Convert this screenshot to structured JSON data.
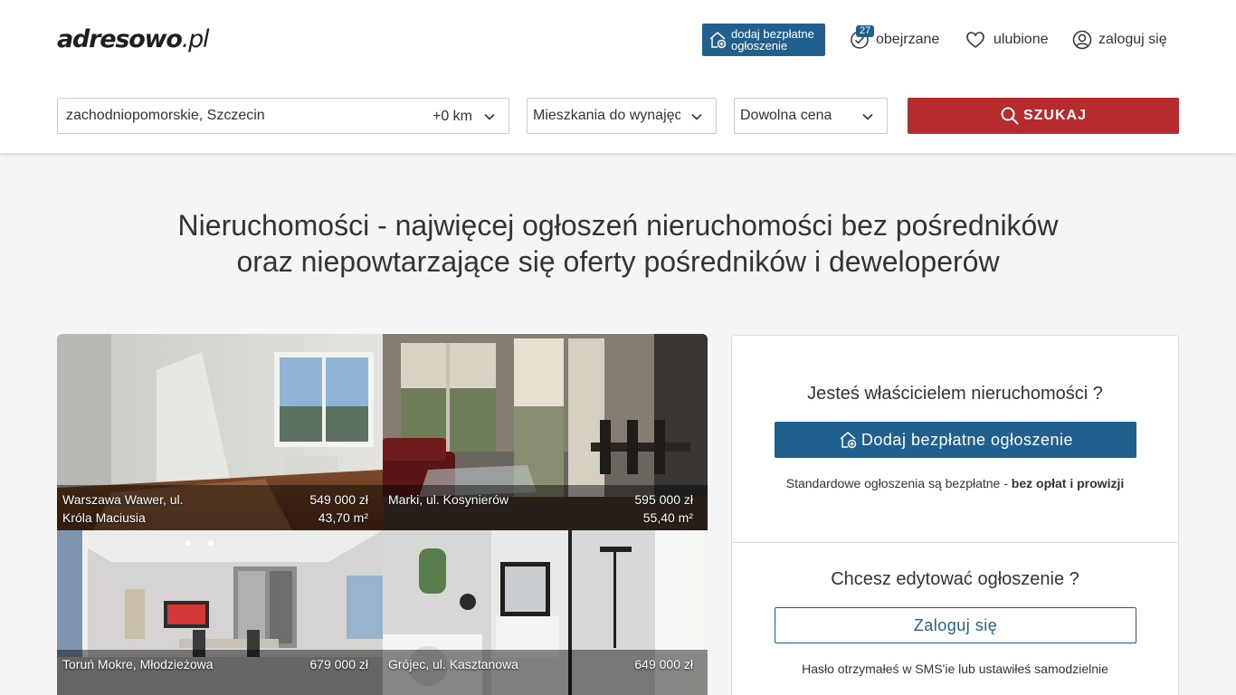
{
  "logo": {
    "main": "adresowo",
    "tld": ".pl"
  },
  "nav": {
    "add_listing": "dodaj bezpłatne ogłoszenie",
    "viewed": "obejrzane",
    "viewed_count": "27",
    "favorites": "ulubione",
    "login": "zaloguj się"
  },
  "search": {
    "location": "zachodniopomorskie,  Szczecin",
    "radius": "+0 km",
    "category": "Mieszkania do wynajęcia",
    "price": "Dowolna cena",
    "button": "SZUKAJ"
  },
  "hero": {
    "line1": "Nieruchomości - najwięcej ogłoszeń nieruchomości bez pośredników",
    "line2": "oraz niepowtarzające się oferty pośredników i deweloperów"
  },
  "listings": [
    {
      "location": "Warszawa Wawer, ul. Króla Maciusia",
      "price": "549 000 zł",
      "area": "43,70 m²"
    },
    {
      "location": "Marki, ul. Kosynierów",
      "price": "595 000 zł",
      "area": "55,40 m²"
    },
    {
      "location": "Toruń Mokre, Młodzieżowa",
      "price": "679 000 zł",
      "area": ""
    },
    {
      "location": "Grójec, ul. Kasztanowa",
      "price": "649 000 zł",
      "area": ""
    }
  ],
  "panel": {
    "owner_question": "Jesteś właścicielem nieruchomości ?",
    "add_button": "Dodaj bezpłatne ogłoszenie",
    "free_note": "Standardowe ogłoszenia są bezpłatne - ",
    "free_note_bold": "bez opłat i prowizji",
    "edit_question": "Chcesz edytować ogłoszenie ?",
    "login_button": "Zaloguj się",
    "password_note": "Hasło otrzymałeś w SMS'ie lub ustawiłeś samodzielnie"
  }
}
